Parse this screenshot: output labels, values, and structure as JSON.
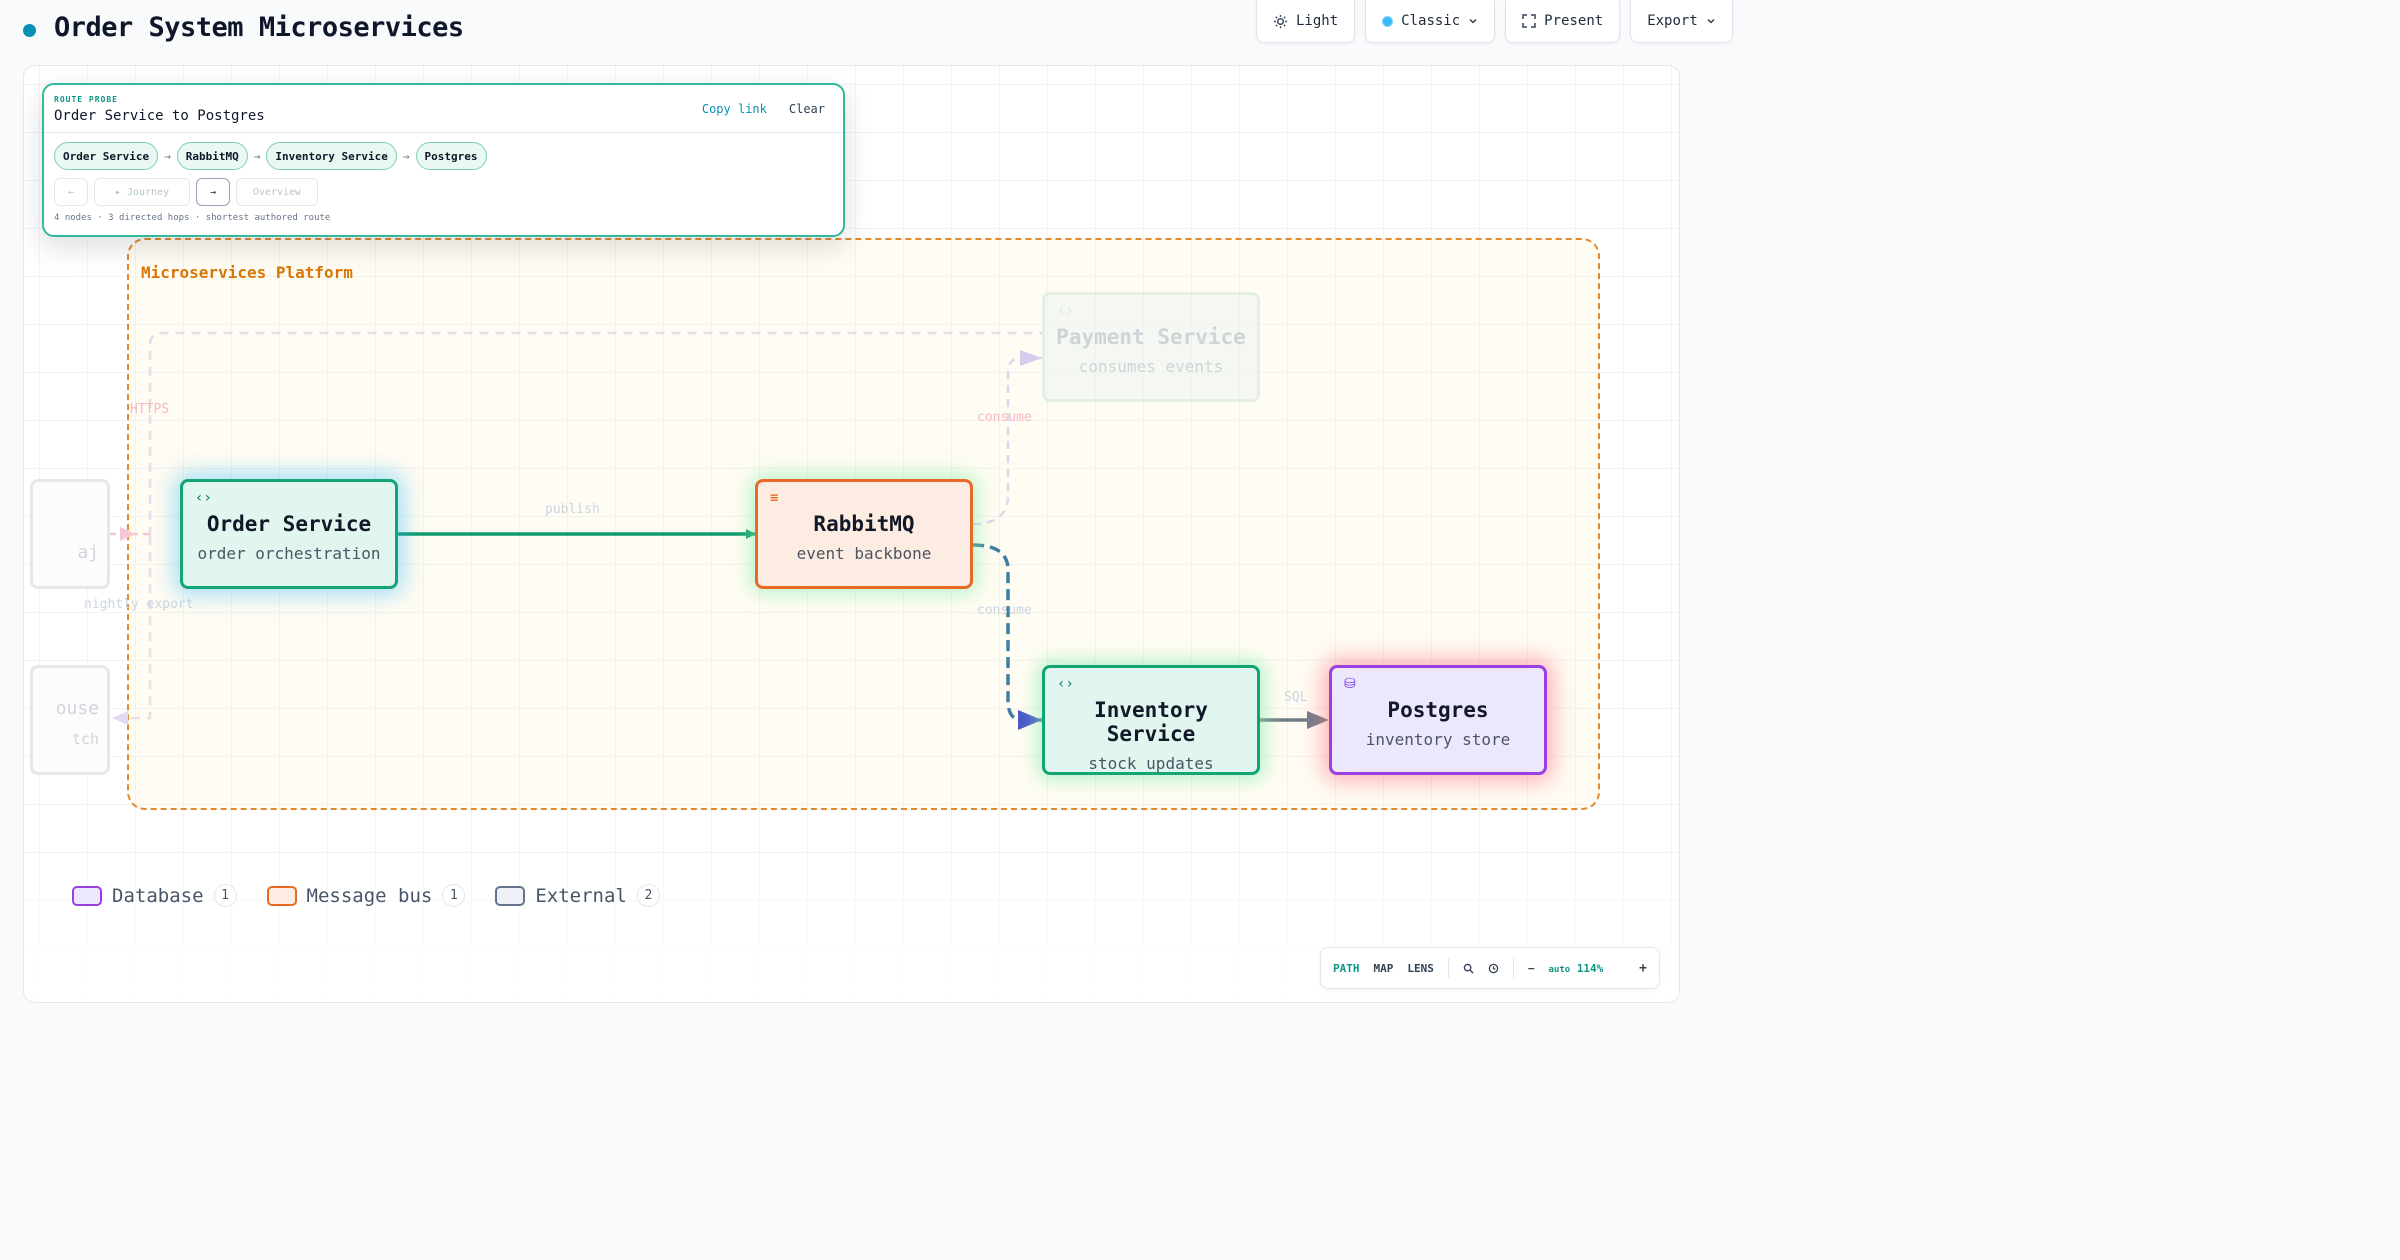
{
  "header": {
    "title": "Order System Microservices"
  },
  "toolbar": {
    "theme_label": "Light",
    "style_label": "Classic",
    "present_label": "Present",
    "export_label": "Export"
  },
  "probe": {
    "kicker": "ROUTE PROBE",
    "title": "Order Service to Postgres",
    "copy_link": "Copy link",
    "clear": "Clear",
    "route": [
      "Order Service",
      "RabbitMQ",
      "Inventory Service",
      "Postgres"
    ],
    "prev": "←",
    "journey": "▸ Journey",
    "next": "→",
    "overview": "Overview",
    "footer": "4 nodes · 3 directed hops · shortest authored route"
  },
  "group": {
    "label": "Microservices Platform"
  },
  "nodes": {
    "order": {
      "title": "Order Service",
      "subtitle": "order orchestration",
      "icon": "‹›"
    },
    "rabbit": {
      "title": "RabbitMQ",
      "subtitle": "event backbone",
      "icon": "≡"
    },
    "inventory": {
      "title": "Inventory Service",
      "subtitle": "stock updates",
      "icon": "‹›"
    },
    "postgres": {
      "title": "Postgres",
      "subtitle": "inventory store",
      "icon": "⛁"
    },
    "payment": {
      "title": "Payment Service",
      "subtitle": "consumes events",
      "icon": "‹›"
    },
    "ghost1": {
      "title": "aj"
    },
    "ghost2": {
      "title": "ouse",
      "subtitle": "tch"
    }
  },
  "edge_labels": {
    "https": "HTTPS",
    "publish": "publish",
    "consume_top": "consume",
    "consume_bottom": "consume",
    "export": "nightly export",
    "sql": "SQL"
  },
  "colors": {
    "accent": "#13a574",
    "bus": "#e86a24",
    "database": "#9b3fe0",
    "group": "#de8a30",
    "active_edge": "#0f9a6a",
    "bus_edge": "#3f7e9f"
  },
  "legend": [
    {
      "label": "Database",
      "count": "1",
      "color": "#9b3fe0",
      "fill": "#ede7fb"
    },
    {
      "label": "Message bus",
      "count": "1",
      "color": "#e86a24",
      "fill": "#fdece2"
    },
    {
      "label": "External",
      "count": "2",
      "color": "#64748b",
      "fill": "#eef2f6"
    }
  ],
  "controls": {
    "path": "PATH",
    "map": "MAP",
    "lens": "LENS",
    "search": "search-icon",
    "history": "clock-icon",
    "zoom_out": "−",
    "zoom_mode": "auto",
    "zoom_value": "114%",
    "zoom_in": "+"
  }
}
